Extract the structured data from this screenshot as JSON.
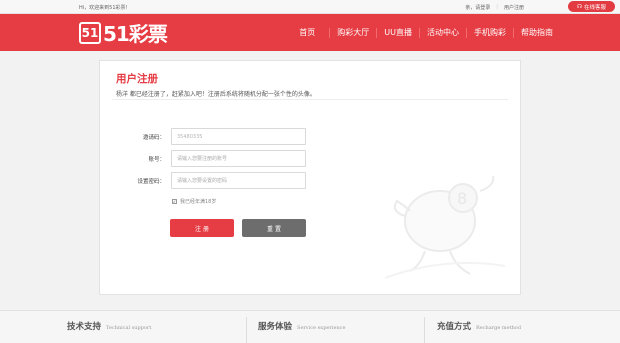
{
  "topbar": {
    "greeting": "Hi，欢迎来到51彩票！",
    "login": "亲，请登录",
    "register": "用户注册",
    "service": "在线客服"
  },
  "logo": {
    "mark": "51",
    "text": "51彩票"
  },
  "nav": [
    {
      "label": "首页"
    },
    {
      "label": "购彩大厅"
    },
    {
      "label": "UU直播"
    },
    {
      "label": "活动中心"
    },
    {
      "label": "手机购彩"
    },
    {
      "label": "帮助指南"
    }
  ],
  "form": {
    "title": "用户注册",
    "subtitle": "杨洋 都已经注册了，赶紧加入吧！注册后系统将随机分配一张个性的头像。",
    "invite_label": "邀请码：",
    "invite_value": "35480335",
    "account_label": "账号：",
    "account_placeholder": "请输入您要注册的账号",
    "password_label": "设置密码：",
    "password_placeholder": "请输入您要设置的密码",
    "agree_text": "我已经年满18岁",
    "agree_checked": true,
    "submit_label": "注 册",
    "reset_label": "重 置"
  },
  "footer": [
    {
      "title": "技术支持",
      "subtitle": "Technical support"
    },
    {
      "title": "服务体验",
      "subtitle": "Service experience"
    },
    {
      "title": "充值方式",
      "subtitle": "Recharge method"
    }
  ],
  "colors": {
    "brand": "#e63c43",
    "secondary_button": "#6d6d6d"
  }
}
